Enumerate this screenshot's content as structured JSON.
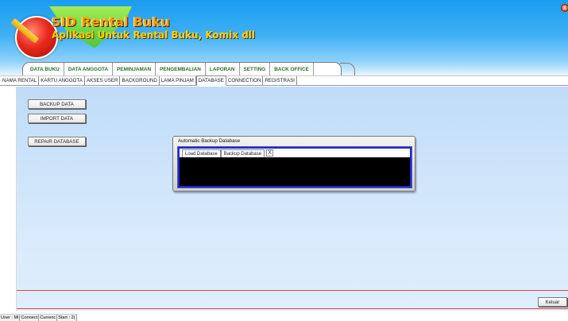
{
  "app": {
    "title": "SID Rental Buku",
    "subtitle": "Aplikasi Untuk Rental Buku, Komix dll",
    "close_glyph": "x"
  },
  "main_menu": [
    {
      "label": "DATA BUKU"
    },
    {
      "label": "DATA ANGGOTA"
    },
    {
      "label": "PEMINJAMAN"
    },
    {
      "label": "PENGEMBALIAN"
    },
    {
      "label": "LAPORAN"
    },
    {
      "label": "SETTING"
    },
    {
      "label": "BACK OFFICE"
    }
  ],
  "sub_tabs": [
    {
      "label": "NAMA RENTAL"
    },
    {
      "label": "KARTU ANGGOTA"
    },
    {
      "label": "AKSES USER"
    },
    {
      "label": "BACKGROUND"
    },
    {
      "label": "LAMA PINJAM"
    },
    {
      "label": "DATABASE",
      "active": true
    },
    {
      "label": "CONNECTION"
    },
    {
      "label": "REGISTRASI"
    }
  ],
  "buttons": {
    "backup": "BACKUP DATA",
    "import": "IMPORT DATA",
    "repair": "REPAIR DATABASE",
    "keluar": "Keluar"
  },
  "dialog": {
    "title": "Automatic Backup Database",
    "tabs": [
      "Load Database",
      "Backup Database"
    ],
    "close_glyph": "X"
  },
  "statusbar": [
    "User : Mi",
    "Connect",
    "Currenc",
    "Start : 2("
  ],
  "colors": {
    "header_blue": "#1a9cf0",
    "content_bg": "#d6e9fb",
    "menu_text": "#2f6a2f",
    "dialog_border": "#1a28d8",
    "bottom_line": "#d84a4a"
  }
}
